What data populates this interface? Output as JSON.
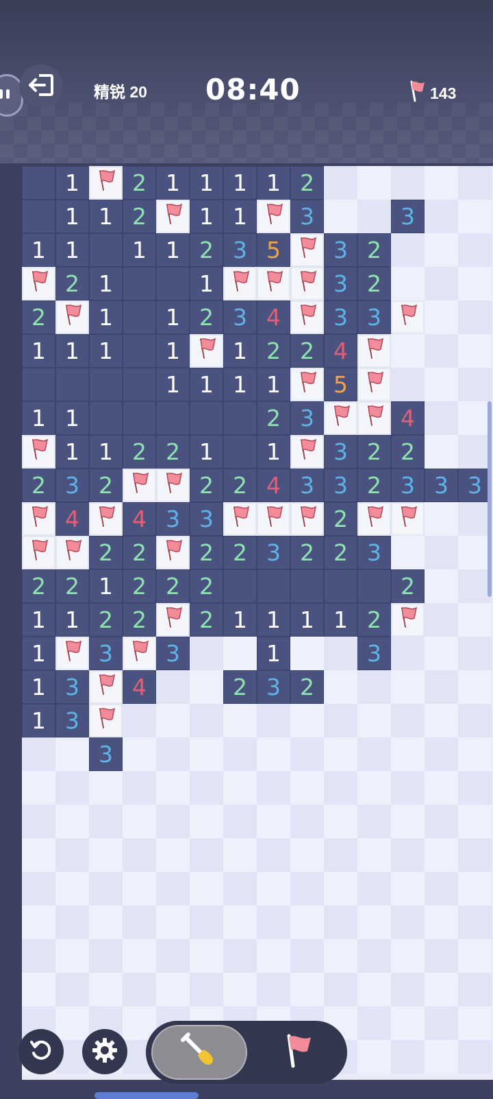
{
  "header": {
    "level_label": "精锐 20",
    "timer": "08:40",
    "flags_remaining": "143"
  },
  "icons": {
    "exit": "exit-icon",
    "flag": "flag-icon",
    "restart": "restart-icon",
    "settings": "gear-icon",
    "dig": "shovel-icon"
  },
  "colors": {
    "open_cell": "#4a5280",
    "hidden_light": "#eef0fb",
    "hidden_dark": "#e1e4f4",
    "num1": "#ffffff",
    "num2": "#8fe3b0",
    "num3": "#5fb3e6",
    "num4": "#e35f78",
    "num5": "#f0a24a",
    "flag": "#f28c9a"
  },
  "board": {
    "cols": 14,
    "rows": 27,
    "legend": "H=hidden, .=open empty, F=flag, digit=number",
    "grid": [
      ".1F21111 2HHHHH",
      ".112F11F3HH3HH",
      "11.112 35F32HHH",
      "F21..1FFF32HHH",
      "2F1.1234F33FHH",
      "111.1F122 4FHHH",
      "....11 11F5FHHH",
      "11.....23FF4HH",
      "F1122 1.1F322H",
      "232FF224332333",
      "F4F433FFF2FFHH",
      "FF22F22322 3HH",
      "221222.....2HH",
      "1122F211112FHH",
      "1F3F3HH1HH3HHH",
      "13F4HH232HHHHH",
      "13FHHHHHHHHHHH",
      "HH3HHHHHHHHHHH",
      "HHHHHHHHHHHHHH",
      "HHHHHHHHHHHHHH",
      "HHHHHHHHHHHHHH",
      "HHHHHHHHHHHHHH",
      "HHHHHHHHHHHHHH",
      "HHHHHHHHHHHHHH",
      "HHHHHHHHHHHHHH",
      "HHHHHHHHHHHHHH",
      "HHHHHHHHHHHHHH"
    ]
  },
  "tools": {
    "selected": "dig"
  }
}
